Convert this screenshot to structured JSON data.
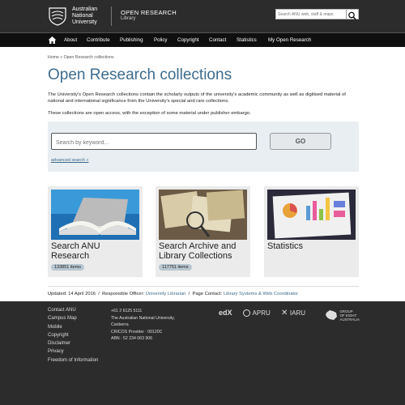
{
  "header": {
    "logo_lines": [
      "Australian",
      "National",
      "University"
    ],
    "site_title": "OPEN RESEARCH",
    "site_subtitle": "Library",
    "search_placeholder": "Search ANU web, staff & maps"
  },
  "nav": {
    "items": [
      "About",
      "Contribute",
      "Publishing",
      "Policy",
      "Copyright",
      "Contact",
      "Statistics",
      "My Open Research"
    ]
  },
  "breadcrumb": "Home » Open Research collections",
  "page_title": "Open Research collections",
  "intro": "The University's Open Research collections contain the scholarly outputs of the university's academic community as well as digitised material of national and international significance from the University's special and rare collections.",
  "intro2": "These collections are open access, with the exception of some material under publisher embargo.",
  "search": {
    "placeholder": "Search by keyword...",
    "go_label": "GO",
    "advanced_label": "advanced search »"
  },
  "cards": [
    {
      "title": "Search ANU Research",
      "count": "133851 items"
    },
    {
      "title": "Search Archive and Library Collections",
      "count": "117751 items"
    },
    {
      "title": "Statistics",
      "count": ""
    }
  ],
  "updated": {
    "label": "Updated:",
    "date": "14 April 2016",
    "officer_label": "Responsible Officer:",
    "officer": "University Librarian",
    "contact_label": "Page Contact:",
    "contact": "Library Systems & Web Coordinator"
  },
  "footer": {
    "links": [
      "Contact ANU",
      "Campus Map",
      "Mobile",
      "Copyright",
      "Disclaimer",
      "Privacy",
      "Freedom of Information"
    ],
    "address": [
      "+61 2 6125 5111",
      "The Australian National University,",
      "Canberra",
      "CRICOS Provider : 00120C",
      "ABN : 52 234 063 906"
    ],
    "partners": [
      "edX",
      "APRU",
      "IARU",
      "GROUP OF EIGHT AUSTRALIA"
    ]
  },
  "colors": {
    "accent": "#3e6b8d",
    "header_bg": "#2c2c2c",
    "nav_bg": "#0f0f0f"
  }
}
